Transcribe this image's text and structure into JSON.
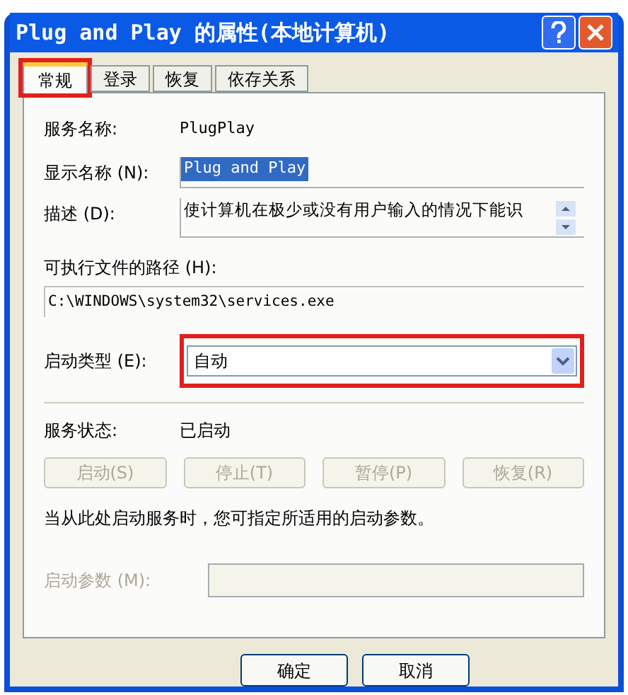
{
  "window": {
    "title": "Plug and Play 的属性(本地计算机)"
  },
  "tabs": [
    {
      "label": "常规",
      "selected": true,
      "highlighted": true
    },
    {
      "label": "登录",
      "selected": false,
      "highlighted": false
    },
    {
      "label": "恢复",
      "selected": false,
      "highlighted": false
    },
    {
      "label": "依存关系",
      "selected": false,
      "highlighted": false
    }
  ],
  "service_name": {
    "label": "服务名称:",
    "value": "PlugPlay"
  },
  "display_name": {
    "label": "显示名称 (N):",
    "value": "Plug and Play",
    "text_selected": true
  },
  "description": {
    "label": "描述 (D):",
    "value": "使计算机在极少或没有用户输入的情况下能识"
  },
  "executable_path": {
    "label": "可执行文件的路径 (H):",
    "value": "C:\\WINDOWS\\system32\\services.exe"
  },
  "startup_type": {
    "label": "启动类型 (E):",
    "value": "自动",
    "highlighted": true
  },
  "service_status": {
    "label": "服务状态:",
    "value": "已启动"
  },
  "control_buttons": [
    {
      "label": "启动(S)",
      "disabled": true
    },
    {
      "label": "停止(T)",
      "disabled": true
    },
    {
      "label": "暂停(P)",
      "disabled": true
    },
    {
      "label": "恢复(R)",
      "disabled": true
    }
  ],
  "hint": "当从此处启动服务时，您可指定所适用的启动参数。",
  "start_parameters": {
    "label": "启动参数 (M):",
    "disabled": true
  },
  "dialog_buttons": [
    "确定",
    "取消"
  ]
}
